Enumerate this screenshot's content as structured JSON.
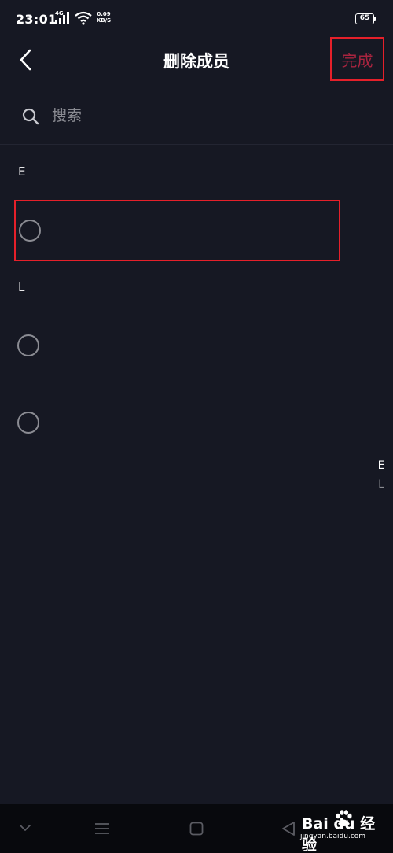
{
  "status_bar": {
    "time": "23:01",
    "signal_label": "4G",
    "net_speed_value": "0.09",
    "net_speed_unit": "KB/S",
    "battery_level": "65",
    "icons": [
      "signal-icon",
      "wifi-icon",
      "battery-icon"
    ]
  },
  "nav": {
    "title": "删除成员",
    "done_label": "完成",
    "back_icon": "chevron-left-icon",
    "done_color": "#a8243f"
  },
  "search": {
    "placeholder": "搜索",
    "value": "",
    "icon": "search-icon"
  },
  "sections": [
    {
      "letter": "E",
      "members": [
        {
          "name": "",
          "selected": false,
          "highlighted": true
        }
      ]
    },
    {
      "letter": "L",
      "members": [
        {
          "name": "",
          "selected": false
        },
        {
          "name": "",
          "selected": false
        }
      ]
    }
  ],
  "index_bar": {
    "letters": [
      "E",
      "L"
    ]
  },
  "bottom_nav": {
    "icons": [
      "chevron-down-icon",
      "menu-icon",
      "home-square-icon",
      "back-triangle-icon"
    ]
  },
  "watermark": {
    "brand": "Bai du 经验",
    "url": "jingyan.baidu.com"
  },
  "colors": {
    "background": "#161823",
    "highlight_border": "#e5202a",
    "bottom_bar": "#08090d"
  }
}
